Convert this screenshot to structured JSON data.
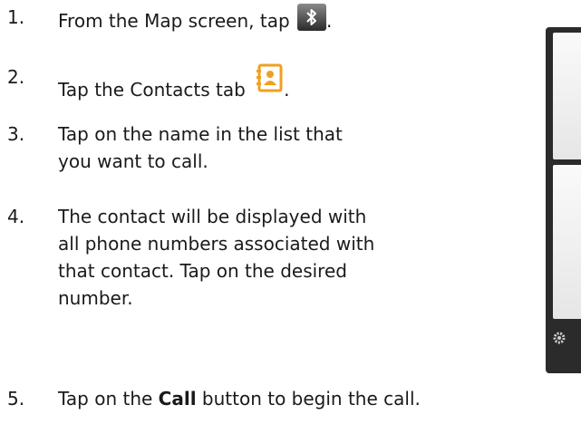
{
  "steps": [
    {
      "number": "1.",
      "lines": [
        "From the Map screen, tap"
      ],
      "trailing": ".",
      "icon": "bluetooth-icon"
    },
    {
      "number": "2.",
      "lines": [
        "Tap the Contacts tab"
      ],
      "trailing": ".",
      "icon": "contacts-icon"
    },
    {
      "number": "3.",
      "lines": [
        "Tap on the name in the list that",
        "you want to call."
      ]
    },
    {
      "number": "4.",
      "lines": [
        "The contact will be displayed with",
        "all phone numbers associated with",
        "that contact.  Tap on the desired",
        "number."
      ]
    },
    {
      "number": "5.",
      "prefix": "Tap on the ",
      "bold": "Call",
      "suffix": " button to begin the call."
    }
  ],
  "colors": {
    "text": "#1a1a1a",
    "contacts_icon": "#f0a020",
    "device_frame": "#2b2b2b"
  },
  "device": {
    "gear_icon": "gear-icon"
  }
}
